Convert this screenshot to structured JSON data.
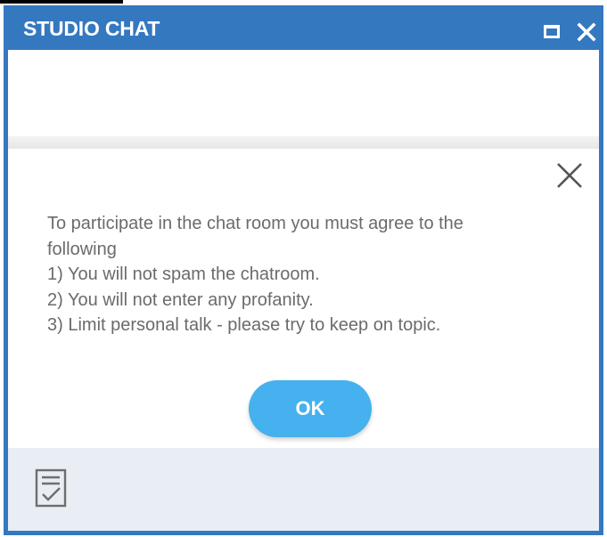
{
  "window": {
    "title": "STUDIO CHAT",
    "maximize_icon": "maximize-icon",
    "close_icon": "close-icon",
    "accent_color": "#3478c0"
  },
  "dialog": {
    "close_icon": "close-icon",
    "message_lines": [
      "To participate in the chat room you must agree to the",
      "following",
      "1) You will not spam the chatroom.",
      "2) You will not enter any profanity.",
      "3) Limit personal talk - please try to keep on topic."
    ],
    "ok_label": "OK",
    "ok_color": "#45b1ee"
  },
  "footer": {
    "transcript_icon": "document-check-icon",
    "background": "#e8eef4"
  }
}
